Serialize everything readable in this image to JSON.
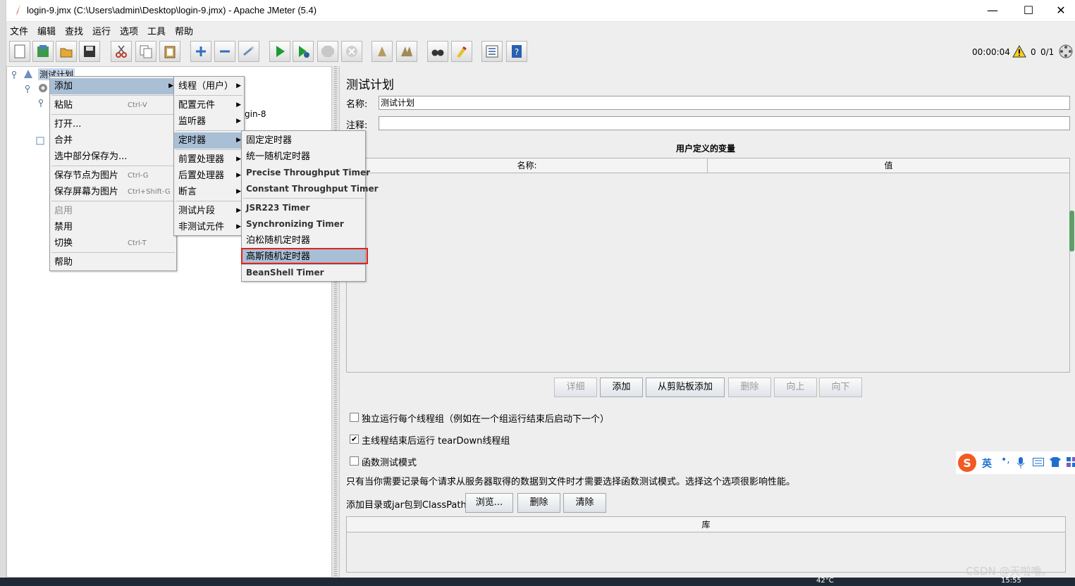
{
  "window": {
    "title": "login-9.jmx (C:\\Users\\admin\\Desktop\\login-9.jmx) - Apache JMeter (5.4)"
  },
  "window_controls": {
    "minimize": "—",
    "maximize": "☐",
    "close": "✕"
  },
  "menubar": [
    "文件",
    "编辑",
    "查找",
    "运行",
    "选项",
    "工具",
    "帮助"
  ],
  "toolbar": {
    "icons": [
      "new-icon",
      "templates-icon",
      "open-icon",
      "save-icon",
      "cut-icon",
      "copy-icon",
      "paste-icon",
      "expand-icon",
      "collapse-icon",
      "toggle-icon",
      "start-icon",
      "start-no-pause-icon",
      "stop-icon",
      "shutdown-icon",
      "clear-icon",
      "clear-all-icon",
      "search-icon",
      "reset-search-icon",
      "function-helper-icon",
      "help-icon"
    ],
    "elapsed_time": "00:00:04",
    "error_count": "0",
    "threads": "0/1"
  },
  "tree": {
    "root": "测试计划",
    "partial_label": "gin-8"
  },
  "context_menu": {
    "items": [
      {
        "label": "添加",
        "accel": "",
        "highlight": true,
        "submenu": true
      },
      {
        "label": "粘贴",
        "accel": "Ctrl-V"
      },
      {
        "label": "打开...",
        "accel": ""
      },
      {
        "label": "合并",
        "accel": ""
      },
      {
        "label": "选中部分保存为...",
        "accel": ""
      },
      {
        "label": "保存节点为图片",
        "accel": "Ctrl-G"
      },
      {
        "label": "保存屏幕为图片",
        "accel": "Ctrl+Shift-G"
      },
      {
        "label": "启用",
        "accel": "",
        "disabled": true
      },
      {
        "label": "禁用",
        "accel": ""
      },
      {
        "label": "切换",
        "accel": "Ctrl-T"
      },
      {
        "label": "帮助",
        "accel": ""
      }
    ]
  },
  "add_submenu": {
    "items": [
      "线程（用户）",
      "配置元件",
      "监听器",
      "定时器",
      "前置处理器",
      "后置处理器",
      "断言",
      "测试片段",
      "非测试元件"
    ]
  },
  "timer_submenu": {
    "items": [
      "固定定时器",
      "统一随机定时器",
      "Precise Throughput Timer",
      "Constant Throughput Timer",
      "JSR223 Timer",
      "Synchronizing Timer",
      "泊松随机定时器",
      "高斯随机定时器",
      "BeanShell Timer"
    ]
  },
  "panel": {
    "heading": "测试计划",
    "name_label": "名称:",
    "name_value": "测试计划",
    "comment_label": "注释:",
    "comment_value": "",
    "vars_title": "用户定义的变量",
    "col_name": "名称:",
    "col_value": "值",
    "buttons": {
      "detail": "详细",
      "add": "添加",
      "add_clipboard": "从剪贴板添加",
      "delete": "删除",
      "up": "向上",
      "down": "向下"
    },
    "opt_serial": "独立运行每个线程组（例如在一个组运行结束后启动下一个）",
    "opt_teardown": "主线程结束后运行 tearDown线程组",
    "opt_functional": "函数测试模式",
    "functional_note": "只有当你需要记录每个请求从服务器取得的数据到文件时才需要选择函数测试模式。选择这个选项很影响性能。",
    "classpath_label": "添加目录或jar包到ClassPath",
    "classpath_buttons": {
      "browse": "浏览...",
      "delete": "删除",
      "clear": "清除"
    },
    "lib_col": "库"
  },
  "ime": {
    "lang": "英"
  },
  "taskbar": {
    "temp": "42°C",
    "time": "15:55"
  },
  "watermark": "CSDN @天啦噜。",
  "colors": {
    "highlight": "#a9bfd6",
    "selection_outline": "#e0241c",
    "background": "#eeeeee"
  }
}
